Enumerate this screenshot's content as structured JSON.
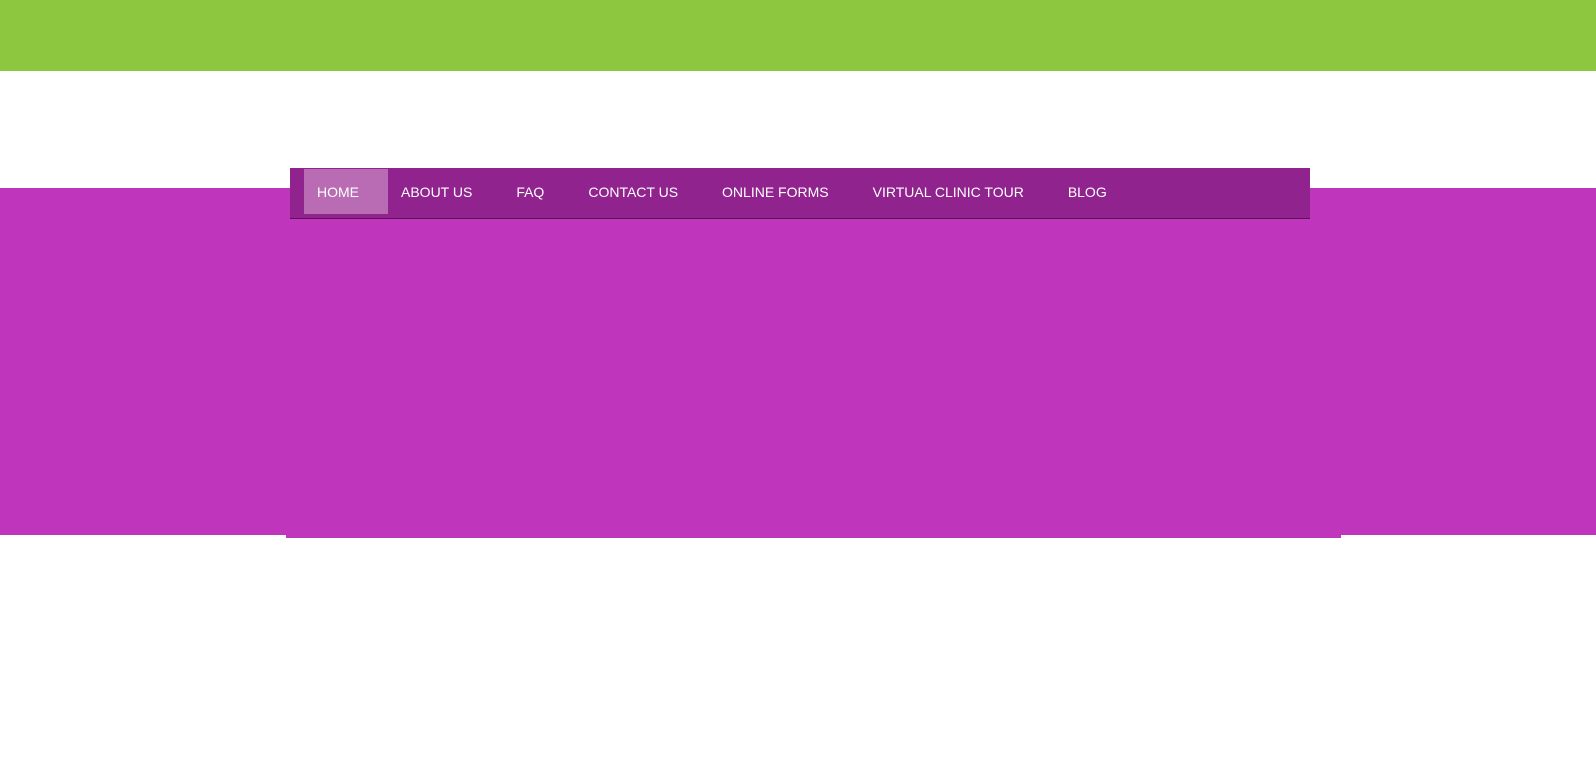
{
  "colors": {
    "top_band": "#8dc63f",
    "hero": "#bf35bb",
    "nav": "#90238d",
    "nav_active": "#b96cb4",
    "nav_text": "#ffffff"
  },
  "nav": {
    "items": [
      {
        "label": "HOME",
        "active": true
      },
      {
        "label": "ABOUT US"
      },
      {
        "label": "FAQ"
      },
      {
        "label": "CONTACT US"
      },
      {
        "label": "ONLINE FORMS"
      },
      {
        "label": "VIRTUAL CLINIC TOUR"
      },
      {
        "label": "BLOG"
      }
    ]
  }
}
